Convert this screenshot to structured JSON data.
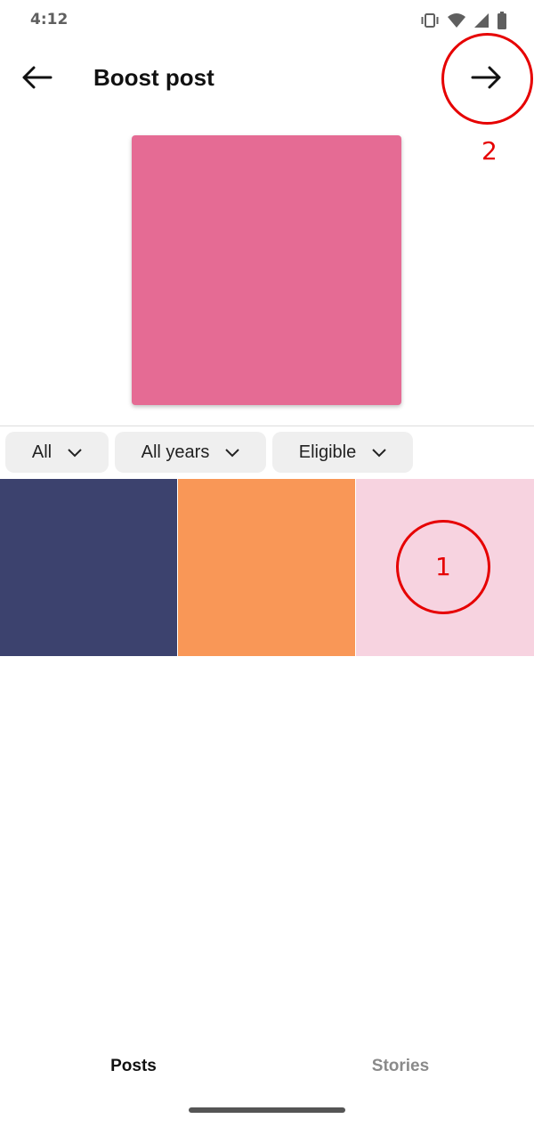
{
  "status_bar": {
    "time": "4:12",
    "icons": [
      "vibrate-icon",
      "wifi-icon",
      "signal-icon",
      "battery-icon"
    ]
  },
  "header": {
    "title": "Boost post",
    "back_icon": "arrow-left-icon",
    "next_icon": "arrow-right-icon"
  },
  "preview": {
    "color": "#e56b94"
  },
  "filters": [
    {
      "label": "All"
    },
    {
      "label": "All years"
    },
    {
      "label": "Eligible"
    }
  ],
  "posts": [
    {
      "color": "#3c426e"
    },
    {
      "color": "#f99757"
    },
    {
      "color": "#f7d3e0"
    }
  ],
  "annotations": {
    "first": "1",
    "second": "2",
    "color": "#e60000"
  },
  "tabs": [
    {
      "label": "Posts",
      "active": true
    },
    {
      "label": "Stories",
      "active": false
    }
  ]
}
